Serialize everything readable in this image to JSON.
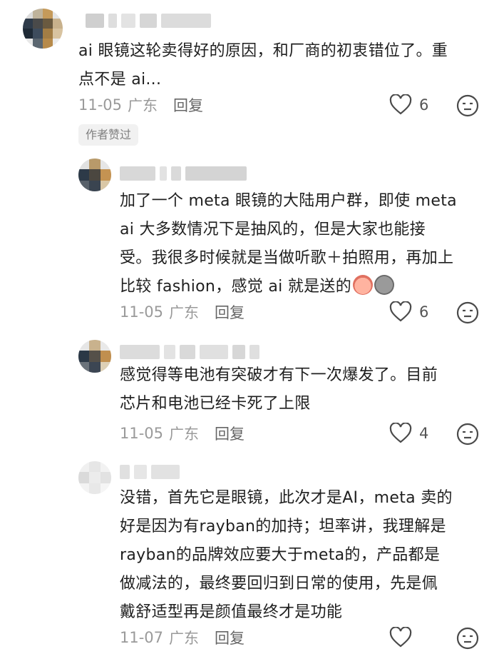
{
  "comments": [
    {
      "body_lines": [
        "ai 眼镜这轮卖得好的原因，和厂商的初衷错位了。重",
        "点不是 ai..."
      ],
      "date": "11-05",
      "location": "广东",
      "reply_label": "回复",
      "likes": "6",
      "badge": "作者赞过"
    },
    {
      "body_lines": [
        "加了一个 meta 眼镜的大陆用户群，即使 meta",
        "ai 大多数情况下是抽风的，但是大家也能接",
        "受。我很多时候就是当做听歌＋拍照用，再加上",
        "比较 fashion，感觉 ai 就是送的"
      ],
      "date": "11-05",
      "location": "广东",
      "reply_label": "回复",
      "likes": "6"
    },
    {
      "body_lines": [
        "感觉得等电池有突破才有下一次爆发了。目前",
        "芯片和电池已经卡死了上限"
      ],
      "date": "11-05",
      "location": "广东",
      "reply_label": "回复",
      "likes": "4"
    },
    {
      "body_lines": [
        "没错，首先它是眼镜，此次才是AI，meta 卖的",
        "好是因为有rayban的加持；坦率讲，我理解是",
        "rayban的品牌效应要大于meta的，产品都是",
        "做减法的，最终要回归到日常的使用，先是佩",
        "戴舒适型再是颜值最终才是功能"
      ],
      "date": "11-07",
      "location": "广东",
      "reply_label": "回复",
      "likes": ""
    }
  ],
  "icons": {
    "like": "heart-outline-icon",
    "dislike": "neutral-face-icon",
    "emoji_1": "crying-laughing-face-emoji",
    "emoji_2": "skull-gray-emoji"
  },
  "colors": {
    "text": "#1f1f1f",
    "meta": "#9a9a9a",
    "badge_bg": "#f1f1f1"
  }
}
